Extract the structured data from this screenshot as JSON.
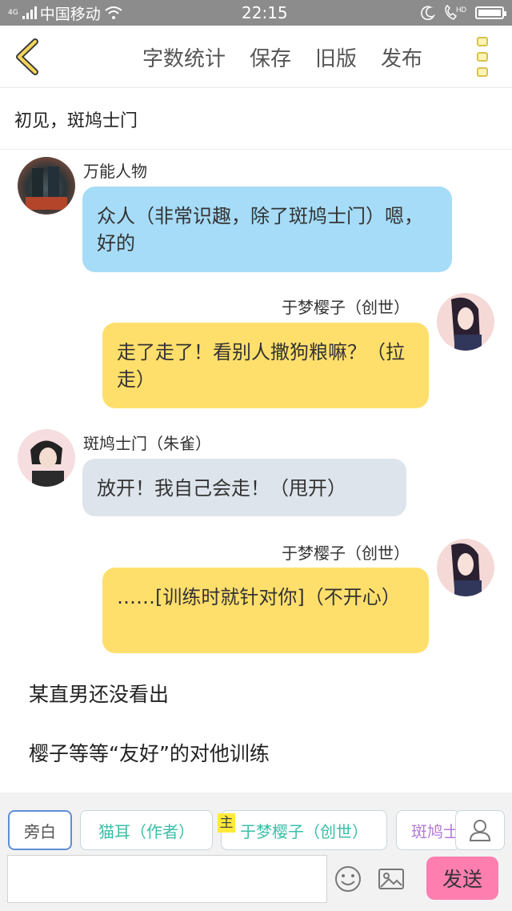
{
  "status_bar": {
    "carrier": "中国移动",
    "network_tag": "4G",
    "time": "22:15",
    "hd_label": "HD"
  },
  "toolbar": {
    "word_count": "字数统计",
    "save": "保存",
    "old_version": "旧版",
    "publish": "发布"
  },
  "chapter_title": "初见，斑鸠士门",
  "messages": [
    {
      "speaker": "万能人物",
      "text": "众人（非常识趣，除了斑鸠士门）嗯，好的"
    },
    {
      "speaker": "于梦樱子（创世）",
      "text": "走了走了！看别人撒狗粮嘛？（拉走）"
    },
    {
      "speaker": "斑鸠士门（朱雀）",
      "text": "放开！我自己会走！（甩开）"
    },
    {
      "speaker": "于梦樱子（创世）",
      "text": "……[训练时就针对你]（不开心）"
    }
  ],
  "narration": [
    "某直男还没看出",
    "樱子等等“友好”的对他训练"
  ],
  "roles": [
    "旁白",
    "猫耳（作者）",
    "于梦樱子（创世）",
    "斑鸠士"
  ],
  "main_tag": "主",
  "send_label": "发送",
  "colors": {
    "accent_yellow": "#ffdf6b",
    "bubble_blue": "#a6dcf7",
    "send_pink": "#ff7eb0",
    "teal_role": "#3bbfa8"
  }
}
